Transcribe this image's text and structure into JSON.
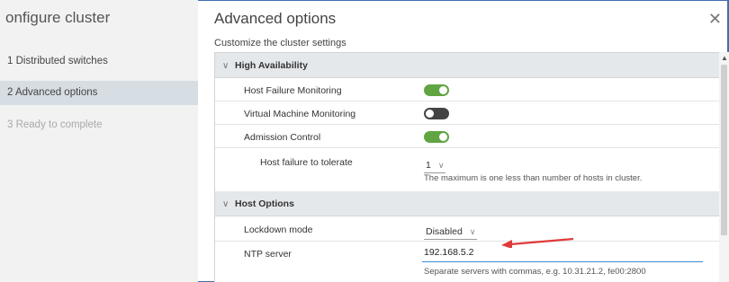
{
  "wizard": {
    "title": "onfigure cluster",
    "steps": [
      {
        "label": "1  Distributed switches"
      },
      {
        "label": "2  Advanced options"
      },
      {
        "label": "3  Ready to complete"
      }
    ]
  },
  "main": {
    "title": "Advanced options",
    "subtitle": "Customize the cluster settings",
    "close_icon": "close-icon"
  },
  "ha": {
    "header": "High Availability",
    "host_failure_monitoring": {
      "label": "Host Failure Monitoring",
      "enabled": true
    },
    "vm_monitoring": {
      "label": "Virtual Machine Monitoring",
      "enabled": false
    },
    "admission_control": {
      "label": "Admission Control",
      "enabled": true
    },
    "host_failures": {
      "label": "Host failure to tolerate",
      "value": "1",
      "hint": "The maximum is one less than number of hosts in cluster."
    }
  },
  "host_options": {
    "header": "Host Options",
    "lockdown": {
      "label": "Lockdown mode",
      "value": "Disabled"
    },
    "ntp": {
      "label": "NTP server",
      "value": "192.168.5.2",
      "hint": "Separate servers with commas, e.g. 10.31.21.2, fe00:2800"
    }
  },
  "colors": {
    "toggle_on": "#60a541",
    "toggle_off": "#444444",
    "input_focus": "#3a8bd8",
    "annotation_arrow": "#e03a3a",
    "frame_border": "#3f6fb0"
  }
}
